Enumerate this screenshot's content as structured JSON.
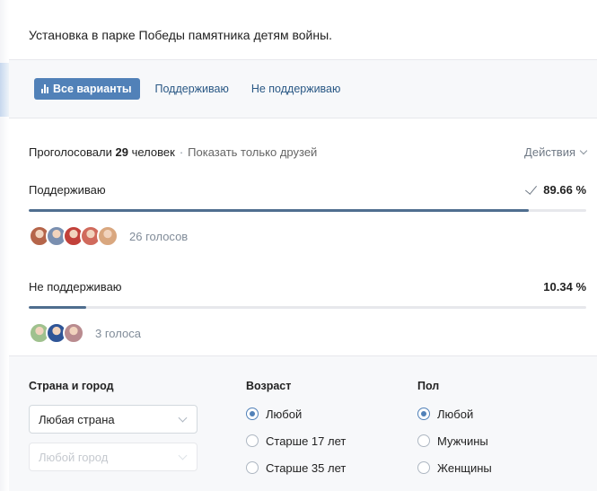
{
  "poll": {
    "question": "Установка в парке Победы памятника детям войны."
  },
  "tabs": {
    "all_label": "Все варианты",
    "support_label": "Поддерживаю",
    "not_support_label": "Не поддерживаю"
  },
  "summary": {
    "voted_prefix": "Проголосовали",
    "voted_count": "29",
    "voted_suffix": "человек",
    "separator": "·",
    "friends_link": "Показать только друзей",
    "actions_label": "Действия"
  },
  "options": [
    {
      "label": "Поддерживаю",
      "percent_text": "89.66 %",
      "percent": 89.66,
      "chosen": true,
      "votes_text": "26 голосов",
      "avatar_colors": [
        "#b5654a",
        "#7a8fb0",
        "#c2413a",
        "#d06a5c",
        "#d9a77f"
      ]
    },
    {
      "label": "Не поддерживаю",
      "percent_text": "10.34 %",
      "percent": 10.34,
      "chosen": false,
      "votes_text": "3 голоса",
      "avatar_colors": [
        "#9fc18e",
        "#2f5597",
        "#b98b8f"
      ]
    }
  ],
  "filters": {
    "location": {
      "heading": "Страна и город",
      "country_value": "Любая страна",
      "city_placeholder": "Любой город"
    },
    "age": {
      "heading": "Возраст",
      "options": [
        "Любой",
        "Старше 17 лет",
        "Старше 35 лет"
      ],
      "selected_index": 0
    },
    "sex": {
      "heading": "Пол",
      "options": [
        "Любой",
        "Мужчины",
        "Женщины"
      ],
      "selected_index": 0
    }
  },
  "colors": {
    "accent": "#5181b8",
    "bar_fill": "#4f6e8f",
    "link": "#2a5885"
  }
}
